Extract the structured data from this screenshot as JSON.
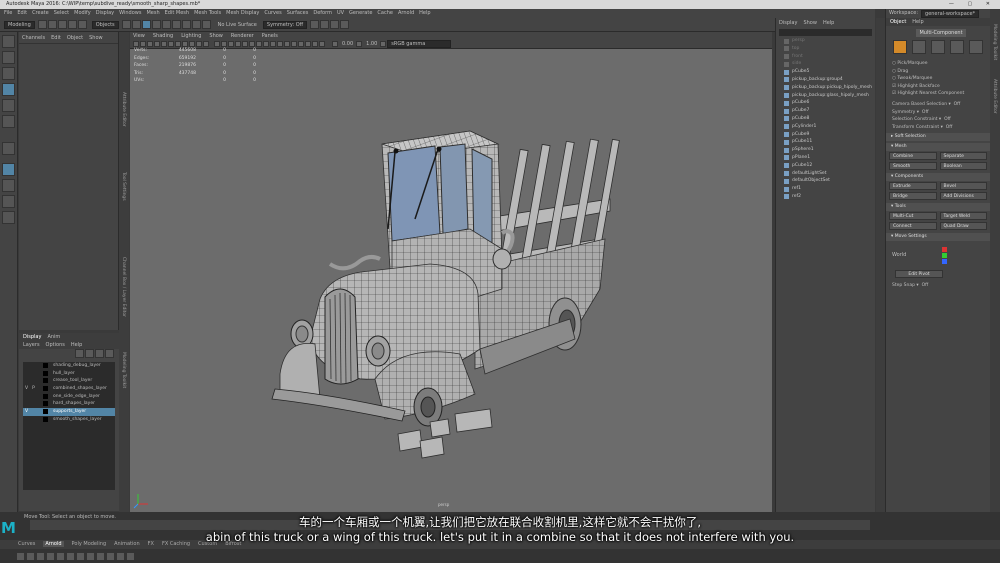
{
  "window": {
    "title": "Autodesk Maya 2016: C:\\WIP\\temp\\subdive_ready\\smooth_sharp_shapes.mb*"
  },
  "menubar": [
    "File",
    "Edit",
    "Create",
    "Select",
    "Modify",
    "Display",
    "Windows",
    "Mesh",
    "Edit Mesh",
    "Mesh Tools",
    "Mesh Display",
    "Curves",
    "Surfaces",
    "Deform",
    "UV",
    "Generate",
    "Cache",
    "Arnold",
    "Help"
  ],
  "statusline": {
    "mode": "Modeling",
    "objects_label": "Objects",
    "live_surface": "No Live Surface",
    "symmetry": "Symmetry: Off"
  },
  "channel_box": {
    "tabs": [
      "Channels",
      "Edit",
      "Object",
      "Show"
    ]
  },
  "layer_editor": {
    "tabs": [
      "Display",
      "Anim"
    ],
    "menu": [
      "Layers",
      "Options",
      "Help"
    ],
    "layers": [
      {
        "v": "",
        "p": "",
        "name": "shading_debug_layer"
      },
      {
        "v": "",
        "p": "",
        "name": "hull_layer"
      },
      {
        "v": "",
        "p": "",
        "name": "crease_tool_layer"
      },
      {
        "v": "V",
        "p": "P",
        "name": "combined_shapes_layer"
      },
      {
        "v": "",
        "p": "",
        "name": "one_side_edge_layer"
      },
      {
        "v": "",
        "p": "",
        "name": "hard_shapes_layer"
      },
      {
        "v": "V",
        "p": "",
        "name": "supports_layer"
      },
      {
        "v": "",
        "p": "",
        "name": "smooth_shapes_layer"
      }
    ],
    "selected_index": 6
  },
  "side_strips": {
    "left": [
      "Attribute Editor",
      "Tool Settings",
      "Channel Box / Layer Editor",
      "Modeling Toolkit"
    ],
    "right": [
      "Modeling Toolkit",
      "Attribute Editor"
    ]
  },
  "viewport": {
    "menu": [
      "View",
      "Shading",
      "Lighting",
      "Show",
      "Renderer",
      "Panels"
    ],
    "exposure": "0.00",
    "gamma": "1.00",
    "colorspace": "sRGB gamma",
    "hud": [
      {
        "k": "Verts:",
        "a": "445608",
        "b": "0",
        "c": "0"
      },
      {
        "k": "Edges:",
        "a": "659192",
        "b": "0",
        "c": "0"
      },
      {
        "k": "Faces:",
        "a": "219876",
        "b": "0",
        "c": "0"
      },
      {
        "k": "Tris:",
        "a": "437748",
        "b": "0",
        "c": "0"
      },
      {
        "k": "UVs:",
        "a": "",
        "b": "0",
        "c": "0"
      }
    ],
    "camera": "persp"
  },
  "outliner": {
    "menu": [
      "Display",
      "Show",
      "Help"
    ],
    "items": [
      {
        "name": "persp",
        "dim": true
      },
      {
        "name": "top",
        "dim": true
      },
      {
        "name": "front",
        "dim": true
      },
      {
        "name": "side",
        "dim": true
      },
      {
        "name": "pCube5",
        "dim": false
      },
      {
        "name": "pickup_backup:group4",
        "dim": false
      },
      {
        "name": "pickup_backup:pickup_hipoly_mesh",
        "dim": false
      },
      {
        "name": "pickup_backup:glass_hipoly_mesh",
        "dim": false
      },
      {
        "name": "pCube6",
        "dim": false
      },
      {
        "name": "pCube7",
        "dim": false
      },
      {
        "name": "pCube8",
        "dim": false
      },
      {
        "name": "pCylinder1",
        "dim": false
      },
      {
        "name": "pCube9",
        "dim": false
      },
      {
        "name": "pCube11",
        "dim": false
      },
      {
        "name": "pSphere1",
        "dim": false
      },
      {
        "name": "pPlane1",
        "dim": false
      },
      {
        "name": "pCube12",
        "dim": false
      },
      {
        "name": "defaultLightSet",
        "dim": false
      },
      {
        "name": "defaultObjectSet",
        "dim": false
      },
      {
        "name": "ref1",
        "dim": false
      },
      {
        "name": "ref2",
        "dim": false
      }
    ]
  },
  "modeling_toolkit": {
    "workspace": "Workspace:",
    "workspace_value": "general-workspace*",
    "tabs": [
      "Object",
      "Help"
    ],
    "multi_component": "Multi-Component",
    "pick_options": [
      "Pick/Marquee",
      "Drag",
      "Tweak/Marquee",
      "Highlight Backface",
      "Highlight Nearest Component"
    ],
    "camera_based": "Camera Based Selection",
    "camera_based_val": "Off",
    "symmetry": "Symmetry",
    "symmetry_val": "Off",
    "selection_constraint": "Selection Constraint",
    "selection_constraint_val": "Off",
    "transform_constraint": "Transform Constraint",
    "transform_constraint_val": "Off",
    "soft_selection": "Soft Selection",
    "sections": {
      "mesh": {
        "title": "Mesh",
        "buttons": [
          "Combine",
          "Separate",
          "Smooth",
          "Boolean"
        ]
      },
      "components": {
        "title": "Components",
        "buttons": [
          "Extrude",
          "Bevel",
          "Bridge",
          "Add Divisions"
        ]
      },
      "tools": {
        "title": "Tools",
        "buttons": [
          "Multi-Cut",
          "Target Weld",
          "Connect",
          "Quad Draw"
        ]
      }
    },
    "move_settings": "Move Settings",
    "world": "World",
    "edit_pivot": "Edit Pivot",
    "step_snap": "Step Snap",
    "step_snap_val": "Off"
  },
  "bottom": {
    "help_line": "Move Tool: Select an object to move.",
    "shelf_tabs": [
      "Curves",
      "Arnold",
      "Poly Modeling",
      "Animation",
      "FX",
      "FX Caching",
      "Custom",
      "Bifrost"
    ]
  },
  "subtitles": {
    "cn": "车的一个车厢或一个机翼,让我们把它放在联合收割机里,这样它就不会干扰你了,",
    "en": "abin of this truck or a wing of this truck. let's put it in a combine so that it does not interfere with you."
  },
  "colors": {
    "accent": "#5285a6",
    "mesh": "#bdbdbd",
    "glass": "#7f95b5",
    "viewport_bg": "#6c6c6c"
  }
}
